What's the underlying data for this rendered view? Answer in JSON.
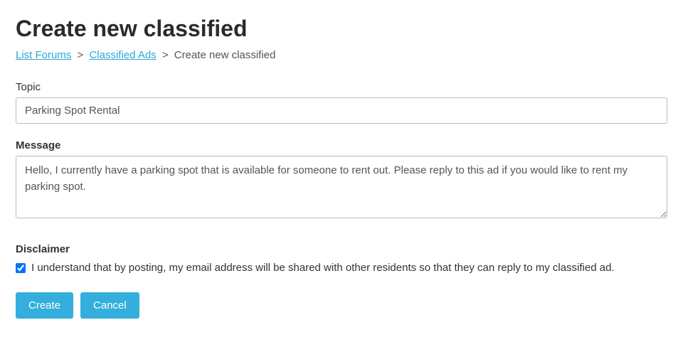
{
  "page": {
    "title": "Create new classified"
  },
  "breadcrumb": {
    "link1": "List Forums",
    "link2": "Classified Ads",
    "sep": ">",
    "current": "Create new classified"
  },
  "form": {
    "topic_label": "Topic",
    "topic_value": "Parking Spot Rental",
    "message_label": "Message",
    "message_value": "Hello, I currently have a parking spot that is available for someone to rent out. Please reply to this ad if you would like to rent my parking spot."
  },
  "disclaimer": {
    "title": "Disclaimer",
    "text": "I understand that by posting, my email address will be shared with other residents so that they can reply to my classified ad."
  },
  "buttons": {
    "create": "Create",
    "cancel": "Cancel"
  }
}
